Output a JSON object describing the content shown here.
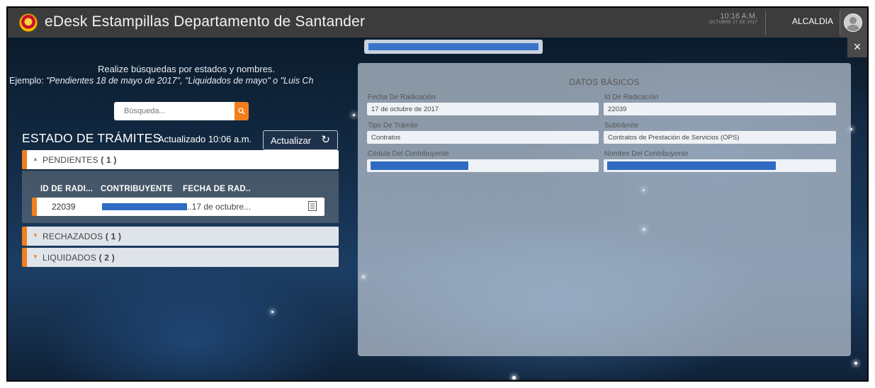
{
  "app": {
    "title": "eDesk Estampillas Departamento de Santander",
    "time": "10:16 A.M.",
    "date": "OCTUBRE 17 DE 2017",
    "user_role": "ALCALDIA"
  },
  "search": {
    "hint_line1": "Realize búsquedas por estados y nombres.",
    "hint_prefix": "Ejemplo: ",
    "hint_examples": "\"Pendientes 18 de mayo de 2017\", \"Liquidados de mayo\" o \"Luis Ch",
    "placeholder": "Búsqueda..."
  },
  "tramites": {
    "title": "ESTADO DE TRÁMITES",
    "updated": "Actualizado 10:06 a.m.",
    "refresh_label": "Actualizar",
    "columns": [
      "ID DE RADI...",
      "CONTRIBUYENTE",
      "FECHA DE RAD.."
    ],
    "sections": {
      "pendientes": {
        "label": "PENDIENTES",
        "count": "( 1 )"
      },
      "rechazados": {
        "label": "RECHAZADOS",
        "count": "( 1 )"
      },
      "liquidados": {
        "label": "LIQUIDADOS",
        "count": "( 2 )"
      }
    },
    "rows": [
      {
        "id": "22039",
        "fecha": "..17 de octubre..."
      }
    ]
  },
  "detail": {
    "close": "×",
    "section_title": "DATOS BÁSICOS",
    "fields": {
      "fecha_label": "Fecha De Radicación",
      "fecha_value": "17 de octubre de 2017",
      "id_label": "Id De Radicación",
      "id_value": "22039",
      "tipo_label": "Tipo De Trámite",
      "tipo_value": "Contratos",
      "sub_label": "Subtrámite",
      "sub_value": "Contratos de Prestación de Servicios (OPS)",
      "cedula_label": "Cédula Del Contribuyente",
      "nombre_label": "Nombre Del Contribuyente"
    }
  },
  "colors": {
    "accent": "#f27e1d",
    "topbar": "#3c3c3c",
    "redaction": "#2f6bc2"
  }
}
